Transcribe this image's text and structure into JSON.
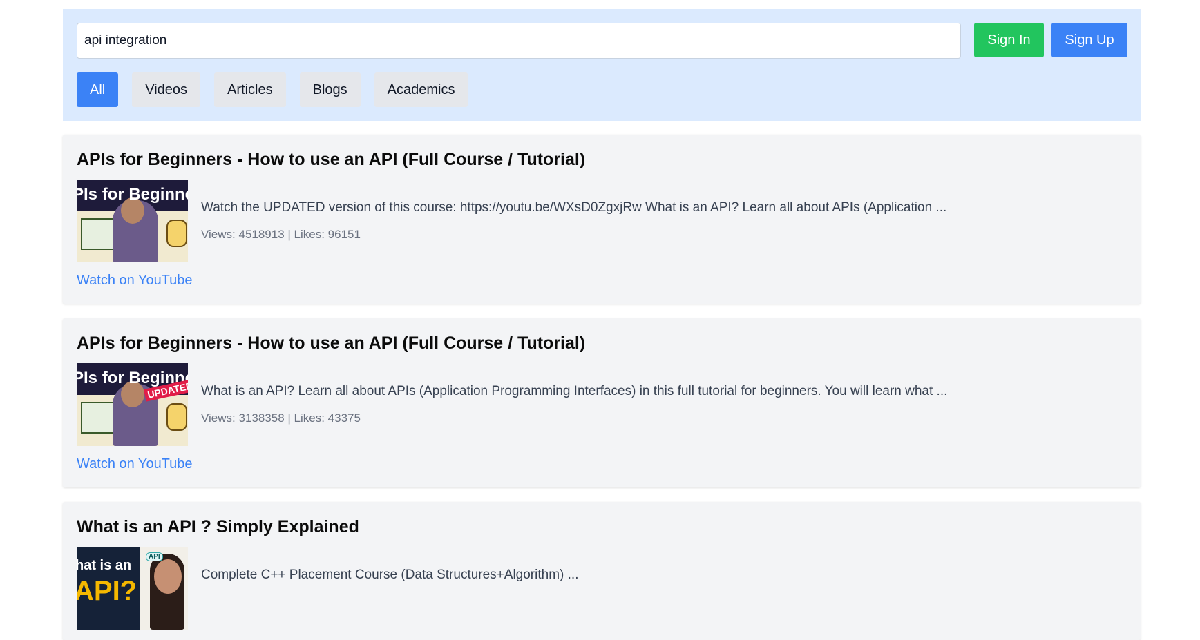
{
  "search": {
    "value": "api integration"
  },
  "auth": {
    "sign_in_label": "Sign In",
    "sign_up_label": "Sign Up"
  },
  "tabs": [
    {
      "label": "All",
      "active": true
    },
    {
      "label": "Videos",
      "active": false
    },
    {
      "label": "Articles",
      "active": false
    },
    {
      "label": "Blogs",
      "active": false
    },
    {
      "label": "Academics",
      "active": false
    }
  ],
  "results": [
    {
      "title": "APIs for Beginners - How to use an API (Full Course / Tutorial)",
      "thumbnail_text": "PIs for Beginners",
      "description": "Watch the UPDATED version of this course: https://youtu.be/WXsD0ZgxjRw What is an API? Learn all about APIs (Application ...",
      "stats": "Views: 4518913 | Likes: 96151",
      "link_label": "Watch on YouTube"
    },
    {
      "title": "APIs for Beginners - How to use an API (Full Course / Tutorial)",
      "thumbnail_text": "PIs for Beginners",
      "thumbnail_badge": "UPDATED",
      "description": "What is an API? Learn all about APIs (Application Programming Interfaces) in this full tutorial for beginners. You will learn what ...",
      "stats": "Views: 3138358 | Likes: 43375",
      "link_label": "Watch on YouTube"
    },
    {
      "title": "What is an API ? Simply Explained",
      "thumbnail_text_line1": "hat is an",
      "thumbnail_text_line2": "API?",
      "thumbnail_tag": "API",
      "description": "Complete C++ Placement Course (Data Structures+Algorithm) ..."
    }
  ],
  "colors": {
    "header_bg": "#dbeafe",
    "accent_blue": "#3b82f6",
    "sign_in_green": "#22c55e",
    "card_bg": "#f3f4f6",
    "link_blue": "#3b82f6"
  }
}
